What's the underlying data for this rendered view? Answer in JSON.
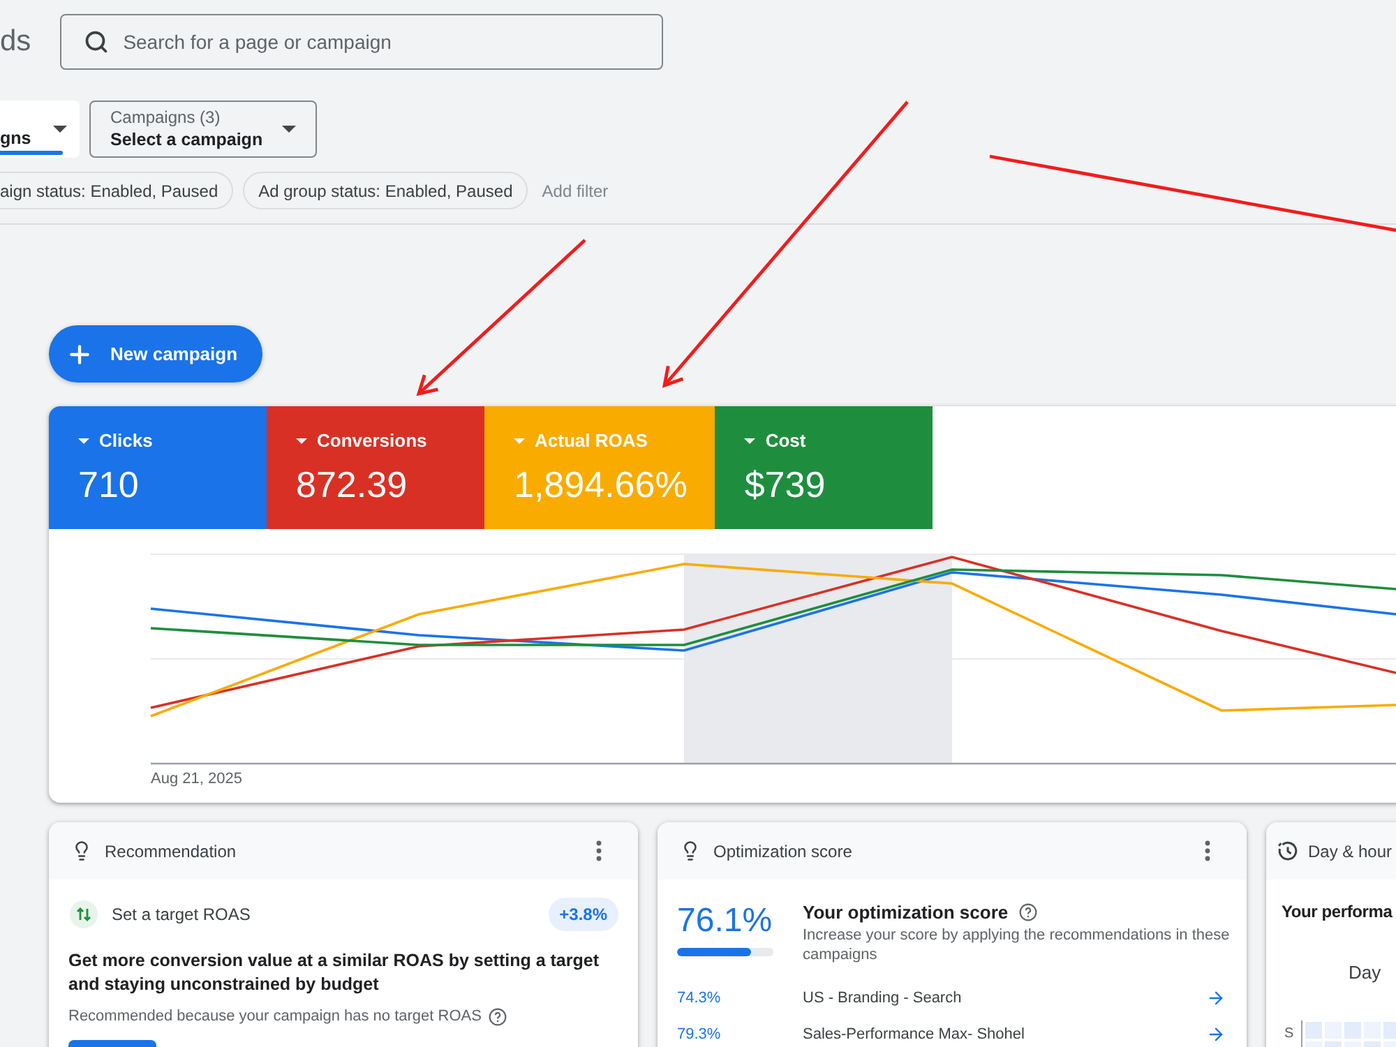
{
  "header": {
    "logo_text": "ds",
    "search": {
      "placeholder": "Search for a page or campaign"
    }
  },
  "dropdowns": [
    {
      "value": "gns",
      "active": true
    },
    {
      "label": "Campaigns (3)",
      "value": "Select a campaign",
      "active": false
    }
  ],
  "filters": {
    "chips": [
      "aign status: Enabled, Paused",
      "Ad group status: Enabled, Paused"
    ],
    "add_filter": "Add filter"
  },
  "new_campaign_button": "New campaign",
  "performance": {
    "metrics": [
      {
        "label": "Clicks",
        "value": "710",
        "color": "#1a73e8"
      },
      {
        "label": "Conversions",
        "value": "872.39",
        "color": "#d93025"
      },
      {
        "label": "Actual ROAS",
        "value": "1,894.66%",
        "color": "#f9ab00"
      },
      {
        "label": "Cost",
        "value": "$739",
        "color": "#1e8e3e"
      }
    ],
    "x_axis_label": "Aug 21, 2025"
  },
  "cards": [
    {
      "kind": "recommendation",
      "title": "Recommendation",
      "suggestion": "Set a target ROAS",
      "badge": "+3.8%",
      "headline": "Get more conversion value at a similar ROAS by setting a target and staying unconstrained by budget",
      "reason": "Recommended because your campaign has no target ROAS"
    },
    {
      "kind": "optimization",
      "title": "Optimization score",
      "score": "76.1%",
      "level": 0.761,
      "heading": "Your optimization score",
      "description": "Increase your score by applying the recommendations in these campaigns",
      "campaigns": [
        {
          "score": "74.3%",
          "name": "US - Branding - Search"
        },
        {
          "score": "79.3%",
          "name": "Sales-Performance Max- Shohel"
        }
      ]
    },
    {
      "kind": "day_hour",
      "title": "Day & hour",
      "heading": "Your performa",
      "axis_label": "Day",
      "row_labels": [
        "S"
      ]
    }
  ]
}
